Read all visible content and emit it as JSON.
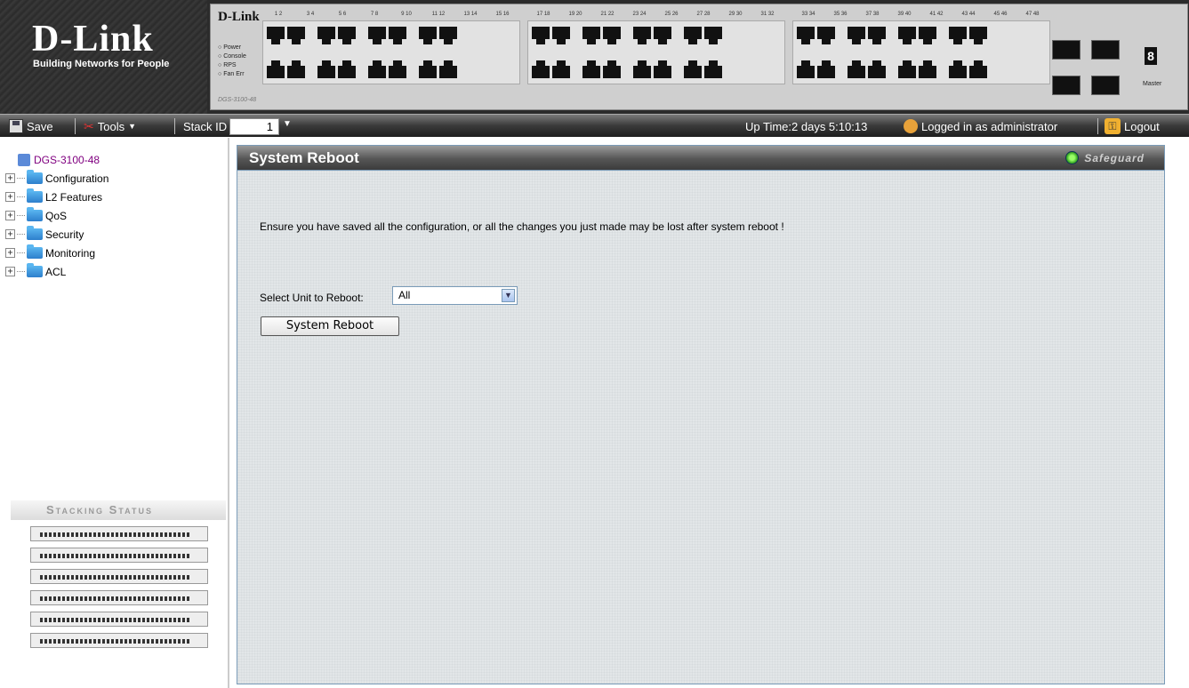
{
  "header": {
    "logo_main": "D-Link",
    "logo_tagline": "Building Networks for People",
    "panel": {
      "brand": "D-Link",
      "leds": [
        "Power",
        "Console",
        "RPS",
        "Fan Err"
      ],
      "model": "DGS-3100-48",
      "port_numbers_1": [
        "1",
        "2",
        "3",
        "4",
        "5",
        "6",
        "7",
        "8",
        "9",
        "10",
        "11",
        "12",
        "13",
        "14",
        "15",
        "16"
      ],
      "port_numbers_2": [
        "17",
        "18",
        "19",
        "20",
        "21",
        "22",
        "23",
        "24",
        "25",
        "26",
        "27",
        "28",
        "29",
        "30",
        "31",
        "32"
      ],
      "port_numbers_3": [
        "33",
        "34",
        "35",
        "36",
        "37",
        "38",
        "39",
        "40",
        "41",
        "42",
        "43",
        "44",
        "45",
        "46",
        "47",
        "48"
      ],
      "unit_digit": "8",
      "master_label": "Master"
    }
  },
  "toolbar": {
    "save_label": "Save",
    "tools_label": "Tools",
    "stack_id_label": "Stack ID",
    "stack_id_value": "1",
    "uptime": "Up Time:2 days 5:10:13",
    "logged_in": "Logged in as administrator",
    "logout_label": "Logout"
  },
  "tree": {
    "root": "DGS-3100-48",
    "items": [
      {
        "label": "Configuration"
      },
      {
        "label": "L2 Features"
      },
      {
        "label": "QoS"
      },
      {
        "label": "Security"
      },
      {
        "label": "Monitoring"
      },
      {
        "label": "ACL"
      }
    ]
  },
  "stacking_status": {
    "title": "Stacking Status",
    "unit_count": 6
  },
  "main": {
    "title": "System Reboot",
    "safeguard_label": "Safeguard",
    "warning": "Ensure you have saved all the configuration, or all the changes you just made may be lost after system reboot !",
    "select_label": "Select Unit to Reboot:",
    "select_value": "All",
    "button_label": "System Reboot"
  }
}
